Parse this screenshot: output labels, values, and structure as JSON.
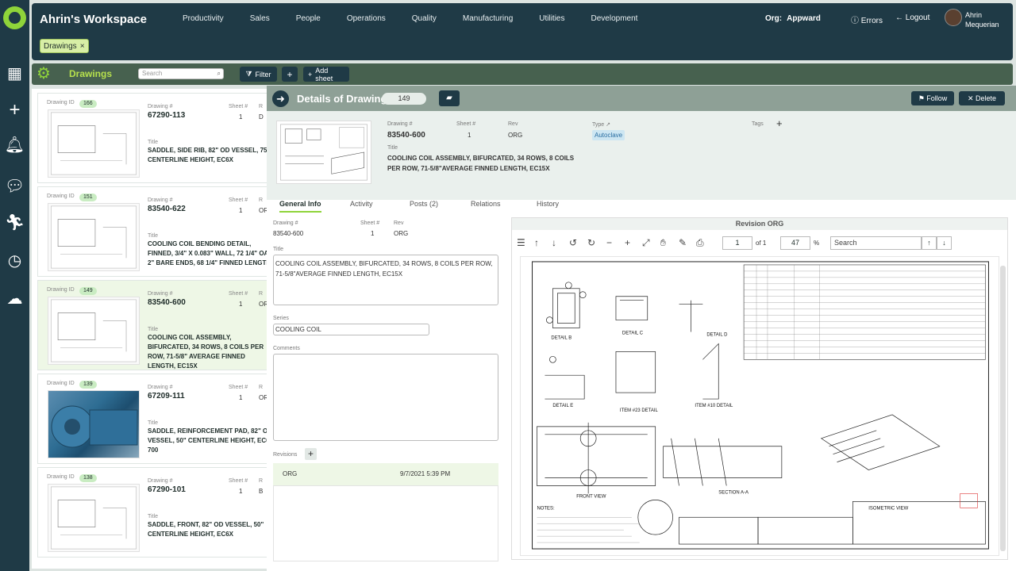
{
  "app": {
    "title": "Ahrin's Workspace"
  },
  "nav": [
    "Productivity",
    "Sales",
    "People",
    "Operations",
    "Quality",
    "Manufacturing",
    "Utilities",
    "Development"
  ],
  "header": {
    "org_label": "Org:",
    "org_value": "Appward",
    "errors": "Errors",
    "logout": "Logout",
    "user_line1": "Ahrin",
    "user_line2": "Mequerian"
  },
  "chip": {
    "label": "Drawings",
    "close": "×"
  },
  "sheet": {
    "title": "Drawings",
    "search_placeholder": "Search",
    "filter": "Filter",
    "add": "+",
    "add_sheet": "Add sheet"
  },
  "list_labels": {
    "drawing_id": "Drawing ID",
    "drawing_num": "Drawing #",
    "sheet_num": "Sheet #",
    "rev": "R",
    "title": "Title"
  },
  "cards": [
    {
      "id": "166",
      "drawing": "67290-113",
      "sheet": "1",
      "rev": "D",
      "title": "SADDLE, SIDE RIB, 82\" OD VESSEL, 75\" CENTERLINE HEIGHT, EC6X"
    },
    {
      "id": "151",
      "drawing": "83540-622",
      "sheet": "1",
      "rev": "OR",
      "title": "COOLING COIL BENDING DETAIL, FINNED, 3/4\" X 0.083\" WALL, 72 1/4\" OAL, 2\" BARE ENDS, 68 1/4\" FINNED LENGTH"
    },
    {
      "id": "149",
      "drawing": "83540-600",
      "sheet": "1",
      "rev": "OR",
      "title": "COOLING COIL ASSEMBLY, BIFURCATED, 34 ROWS, 8 COILS PER ROW, 71-5/8\" AVERAGE FINNED LENGTH, EC15X"
    },
    {
      "id": "139",
      "drawing": "67209-111",
      "sheet": "1",
      "rev": "OR",
      "title": "SADDLE, REINFORCEMENT PAD, 82\" OD VESSEL, 50\" CENTERLINE HEIGHT, EC6X 700"
    },
    {
      "id": "138",
      "drawing": "67290-101",
      "sheet": "1",
      "rev": "B",
      "title": "SADDLE, FRONT, 82\" OD VESSEL, 50\" CENTERLINE HEIGHT, EC6X"
    }
  ],
  "detail": {
    "header": "Details of Drawing",
    "count": "149",
    "follow": "Follow",
    "delete": "Delete",
    "labels": {
      "drawing": "Drawing #",
      "sheet": "Sheet #",
      "rev": "Rev",
      "type": "Type",
      "tags": "Tags",
      "title": "Title"
    },
    "drawing": "83540-600",
    "sheet": "1",
    "rev": "ORG",
    "type": "Autoclave",
    "tags_add": "+",
    "title": "COOLING COIL ASSEMBLY, BIFURCATED, 34 ROWS, 8 COILS PER ROW, 71-5/8\"AVERAGE FINNED LENGTH, EC15X"
  },
  "tabs": [
    "General Info",
    "Activity",
    "Posts (2)",
    "Relations",
    "History"
  ],
  "form": {
    "drawing_label": "Drawing #",
    "drawing": "83540-600",
    "sheet_label": "Sheet #",
    "sheet": "1",
    "rev_label": "Rev",
    "rev": "ORG",
    "title_label": "Title",
    "title": "COOLING COIL ASSEMBLY, BIFURCATED, 34 ROWS, 8 COILS PER ROW, 71-5/8\"AVERAGE FINNED LENGTH, EC15X",
    "series_label": "Series",
    "series": "COOLING COIL",
    "comments_label": "Comments",
    "comments": "",
    "revisions_label": "Revisions",
    "revisions_add": "+",
    "revision_name": "ORG",
    "revision_date": "9/7/2021 5:39 PM"
  },
  "viewer": {
    "title": "Revision ORG",
    "page": "1",
    "of": "of 1",
    "zoom": "47",
    "pct": "%",
    "search_placeholder": "Search",
    "drawing_texts": {
      "detail_b": "DETAIL B",
      "detail_c": "DETAIL C",
      "detail_d": "DETAIL D",
      "detail_e": "DETAIL E",
      "item23": "ITEM #23 DETAIL",
      "item10": "ITEM #10 DETAIL",
      "front": "FRONT VIEW",
      "section": "SECTION A-A",
      "iso": "ISOMETRIC VIEW",
      "notes": "NOTES:"
    }
  }
}
